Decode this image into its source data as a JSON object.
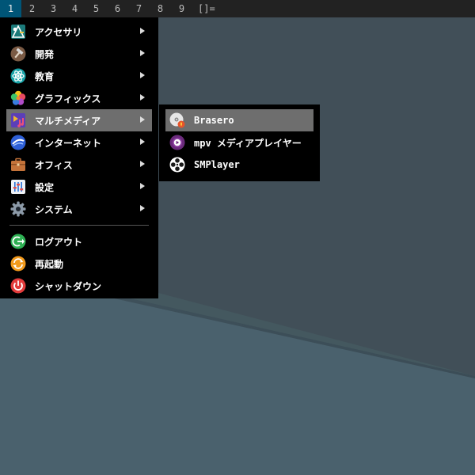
{
  "topbar": {
    "workspaces": [
      "1",
      "2",
      "3",
      "4",
      "5",
      "6",
      "7",
      "8",
      "9"
    ],
    "active_workspace": "1",
    "layout_symbol": "[]="
  },
  "main_menu": {
    "items": [
      {
        "label": "アクセサリ",
        "icon": "accessories-icon",
        "has_submenu": true
      },
      {
        "label": "開発",
        "icon": "development-hammer-icon",
        "has_submenu": true
      },
      {
        "label": "教育",
        "icon": "education-atom-icon",
        "has_submenu": true
      },
      {
        "label": "グラフィックス",
        "icon": "graphics-flower-icon",
        "has_submenu": true
      },
      {
        "label": "マルチメディア",
        "icon": "multimedia-icon",
        "has_submenu": true,
        "highlighted": true
      },
      {
        "label": "インターネット",
        "icon": "internet-globe-icon",
        "has_submenu": true
      },
      {
        "label": "オフィス",
        "icon": "office-briefcase-icon",
        "has_submenu": true
      },
      {
        "label": "設定",
        "icon": "settings-sliders-icon",
        "has_submenu": true
      },
      {
        "label": "システム",
        "icon": "system-gear-icon",
        "has_submenu": true
      }
    ],
    "session_items": [
      {
        "label": "ログアウト",
        "icon": "logout-icon"
      },
      {
        "label": "再起動",
        "icon": "restart-icon"
      },
      {
        "label": "シャットダウン",
        "icon": "power-icon"
      }
    ]
  },
  "submenu": {
    "items": [
      {
        "label": "Brasero",
        "icon": "brasero-disc-icon",
        "highlighted": true
      },
      {
        "label": "mpv メディアプレイヤー",
        "icon": "mpv-icon"
      },
      {
        "label": "SMPlayer",
        "icon": "smplayer-reel-icon"
      }
    ]
  },
  "colors": {
    "topbar_bg": "#222222",
    "active_workspace_bg": "#005577",
    "menu_bg": "#000000",
    "highlight_bg": "#6e6e6e",
    "desktop": "#455963"
  }
}
